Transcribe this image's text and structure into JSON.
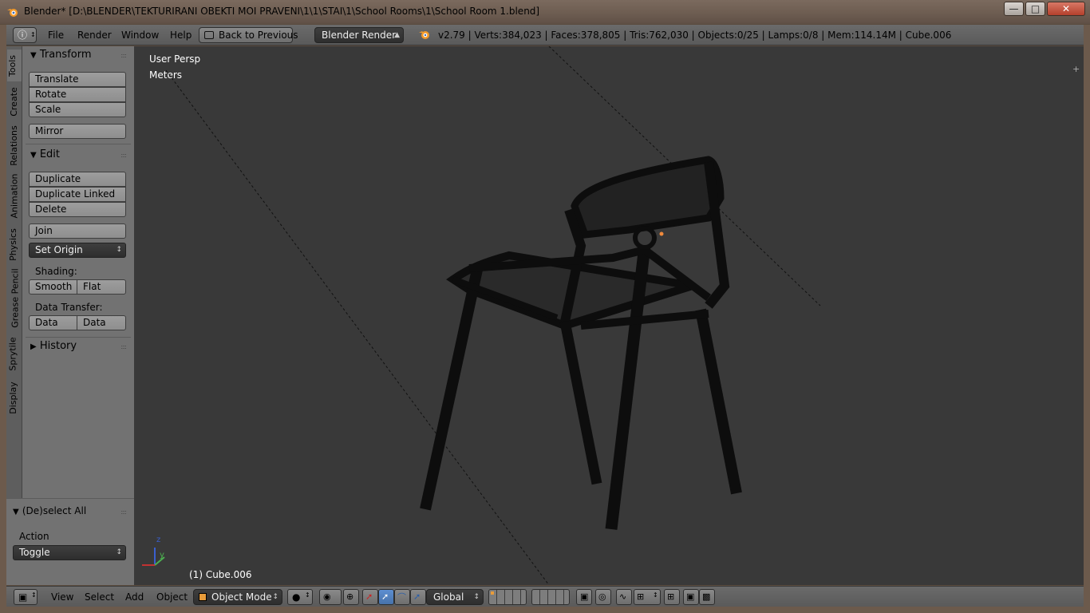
{
  "window": {
    "title": "Blender* [D:\\BLENDER\\TEKTURIRANI OBEKTI MOI PRAVENI\\1\\1\\STAI\\1\\School Rooms\\1\\School Room 1.blend]",
    "buttons": [
      "minimize-icon",
      "maximize-icon",
      "close-icon"
    ]
  },
  "topbar": {
    "menus": [
      "File",
      "Render",
      "Window",
      "Help"
    ],
    "back_button": "Back to Previous",
    "render_engine": "Blender Render",
    "stats": "v2.79 | Verts:384,023 | Faces:378,805 | Tris:762,030 | Objects:0/25 | Lamps:0/8 | Mem:114.14M | Cube.006"
  },
  "shelf": {
    "tabs": [
      "Tools",
      "Create",
      "Relations",
      "Animation",
      "Physics",
      "Grease Pencil",
      "Sprytile",
      "Display"
    ],
    "active_tab": "Tools",
    "transform": {
      "title": "Transform",
      "buttons": [
        "Translate",
        "Rotate",
        "Scale",
        "Mirror"
      ]
    },
    "edit": {
      "title": "Edit",
      "buttons": [
        "Duplicate",
        "Duplicate Linked",
        "Delete",
        "Join"
      ],
      "set_origin": "Set Origin",
      "shading_label": "Shading:",
      "smooth": "Smooth",
      "flat": "Flat",
      "data_transfer_label": "Data Transfer:",
      "data": "Data",
      "data_layo": "Data Layo"
    },
    "history": {
      "title": "History"
    },
    "operator": {
      "title": "(De)select All",
      "action_label": "Action",
      "action_value": "Toggle"
    }
  },
  "viewport": {
    "view_name": "User Persp",
    "units": "Meters",
    "object_info": "(1) Cube.006",
    "axis_z": "z",
    "axis_y": "y"
  },
  "bottombar": {
    "menus": [
      "View",
      "Select",
      "Add",
      "Object"
    ],
    "mode": "Object Mode",
    "orientation": "Global"
  },
  "colors": {
    "viewport_bg": "#393939",
    "panel_bg": "#727272",
    "header_bg": "#5f5f5f",
    "accent_blue": "#5680c2",
    "window_frame": "#6c5a4c"
  }
}
